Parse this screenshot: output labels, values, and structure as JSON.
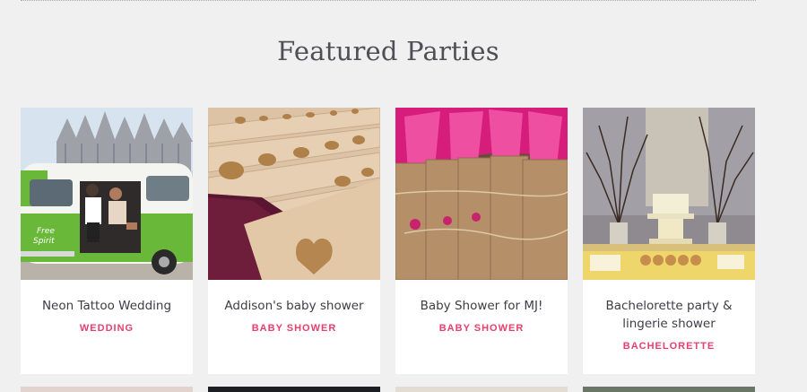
{
  "section": {
    "title": "Featured Parties"
  },
  "cards": [
    {
      "title": "Neon Tattoo Wedding",
      "category": "WEDDING",
      "image": "cathedral-green-van-photo"
    },
    {
      "title": "Addison's baby shower",
      "category": "BABY SHOWER",
      "image": "glitter-heart-cards-photo"
    },
    {
      "title": "Baby Shower for MJ!",
      "category": "BABY SHOWER",
      "image": "pink-favor-bags-photo"
    },
    {
      "title": "Bachelorette party & lingerie shower",
      "category": "BACHELORETTE",
      "image": "dessert-table-branches-photo"
    }
  ],
  "colors": {
    "background": "#f1f0f1",
    "accent": "#e6406f",
    "title": "#4f4f55",
    "card": "#ffffff"
  }
}
